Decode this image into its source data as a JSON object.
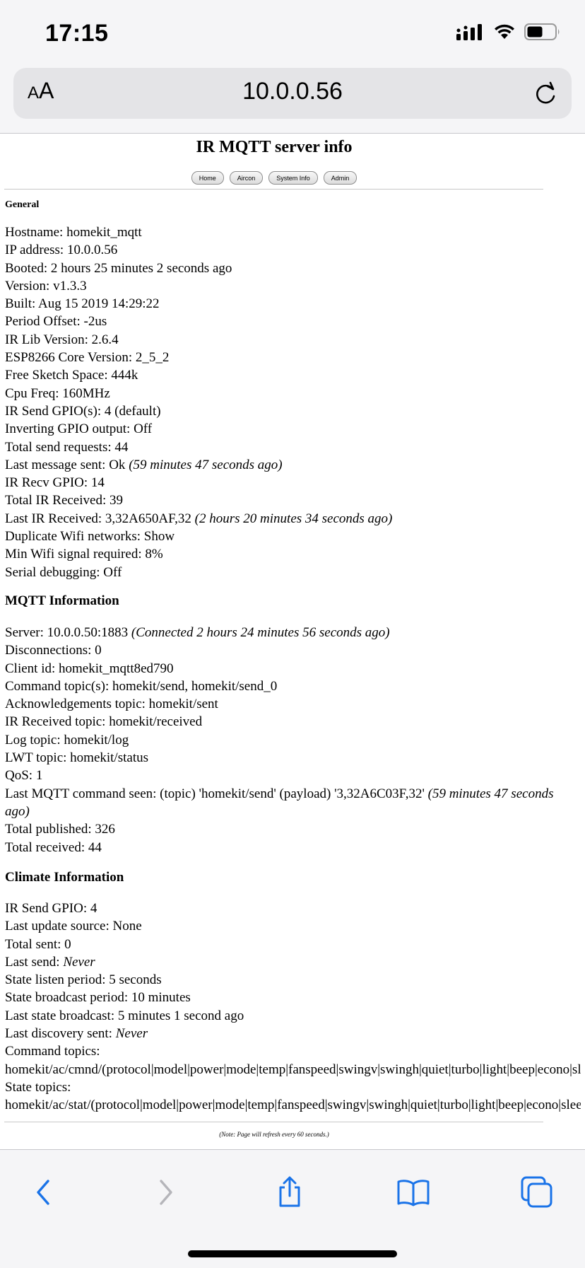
{
  "status_bar": {
    "time": "17:15"
  },
  "browser": {
    "reader_label_small": "A",
    "reader_label_large": "A",
    "url": "10.0.0.56",
    "accent_color": "#1a73e8"
  },
  "page": {
    "title": "IR MQTT server info",
    "nav": [
      "Home",
      "Aircon",
      "System Info",
      "Admin"
    ],
    "general": {
      "heading": "General",
      "lines": [
        {
          "text": "Hostname: homekit_mqtt"
        },
        {
          "text": "IP address: 10.0.0.56"
        },
        {
          "text": "Booted: 2 hours 25 minutes 2 seconds ago"
        },
        {
          "text": "Version: v1.3.3"
        },
        {
          "text": "Built: Aug 15 2019 14:29:22"
        },
        {
          "text": "Period Offset: -2us"
        },
        {
          "text": "IR Lib Version: 2.6.4"
        },
        {
          "text": "ESP8266 Core Version: 2_5_2"
        },
        {
          "text": "Free Sketch Space: 444k"
        },
        {
          "text": "Cpu Freq: 160MHz"
        },
        {
          "text": "IR Send GPIO(s): 4 (default)"
        },
        {
          "text": "Inverting GPIO output: Off"
        },
        {
          "text": "Total send requests: 44"
        },
        {
          "text": "Last message sent: Ok ",
          "note": "(59 minutes 47 seconds ago)"
        },
        {
          "text": "IR Recv GPIO: 14"
        },
        {
          "text": "Total IR Received: 39"
        },
        {
          "text": "Last IR Received: 3,32A650AF,32 ",
          "note": "(2 hours 20 minutes 34 seconds ago)"
        },
        {
          "text": "Duplicate Wifi networks: Show"
        },
        {
          "text": "Min Wifi signal required: 8%"
        },
        {
          "text": "Serial debugging: Off"
        }
      ]
    },
    "mqtt": {
      "heading": "MQTT Information",
      "lines": [
        {
          "text": "Server: 10.0.0.50:1883 ",
          "note": "(Connected 2 hours 24 minutes 56 seconds ago)"
        },
        {
          "text": "Disconnections: 0"
        },
        {
          "text": "Client id: homekit_mqtt8ed790"
        },
        {
          "text": "Command topic(s): homekit/send, homekit/send_0"
        },
        {
          "text": "Acknowledgements topic: homekit/sent"
        },
        {
          "text": "IR Received topic: homekit/received"
        },
        {
          "text": "Log topic: homekit/log"
        },
        {
          "text": "LWT topic: homekit/status"
        },
        {
          "text": "QoS: 1"
        },
        {
          "text": "Last MQTT command seen: (topic) 'homekit/send' (payload) '3,32A6C03F,32' ",
          "note": "(59 minutes 47 seconds ago)",
          "wrap": true
        },
        {
          "text": "Total published: 326"
        },
        {
          "text": "Total received: 44"
        }
      ]
    },
    "climate": {
      "heading": "Climate Information",
      "lines": [
        {
          "text": "IR Send GPIO: 4"
        },
        {
          "text": "Last update source: None"
        },
        {
          "text": "Total sent: 0"
        },
        {
          "text": "Last send: ",
          "note": "Never"
        },
        {
          "text": "State listen period: 5 seconds"
        },
        {
          "text": "State broadcast period: 10 minutes"
        },
        {
          "text": "Last state broadcast: 5 minutes 1 second ago"
        },
        {
          "text": "Last discovery sent: ",
          "note": "Never"
        },
        {
          "text": "Command topics:"
        },
        {
          "text": "homekit/ac/cmnd/(protocol|model|power|mode|temp|fanspeed|swingv|swingh|quiet|turbo|light|beep|econo|sleep|filter|clean|use_celsius)"
        },
        {
          "text": "State topics:"
        },
        {
          "text": "homekit/ac/stat/(protocol|model|power|mode|temp|fanspeed|swingv|swingh|quiet|turbo|light|beep|econo|sleep|filter|clean|use_celsius)"
        }
      ]
    },
    "footer_note": "(Note: Page will refresh every 60 seconds.)"
  }
}
